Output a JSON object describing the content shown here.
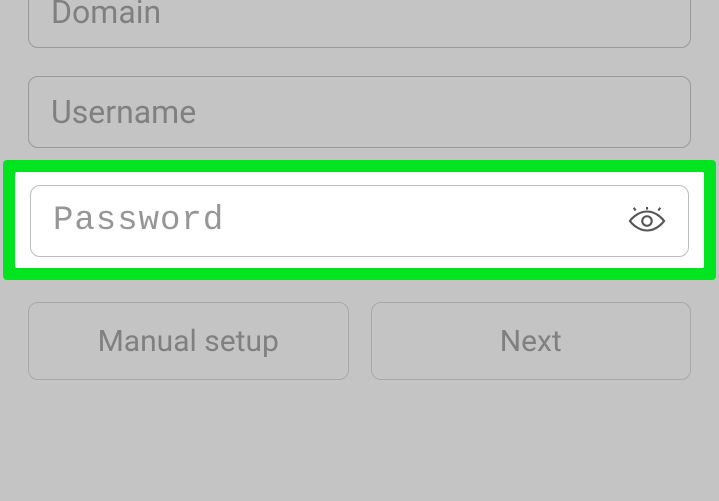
{
  "fields": {
    "domain": {
      "placeholder": "Domain",
      "value": ""
    },
    "username": {
      "placeholder": "Username",
      "value": ""
    },
    "password": {
      "placeholder": "Password",
      "value": ""
    }
  },
  "buttons": {
    "manual_setup": "Manual setup",
    "next": "Next"
  },
  "icons": {
    "eye": "eye-icon"
  }
}
